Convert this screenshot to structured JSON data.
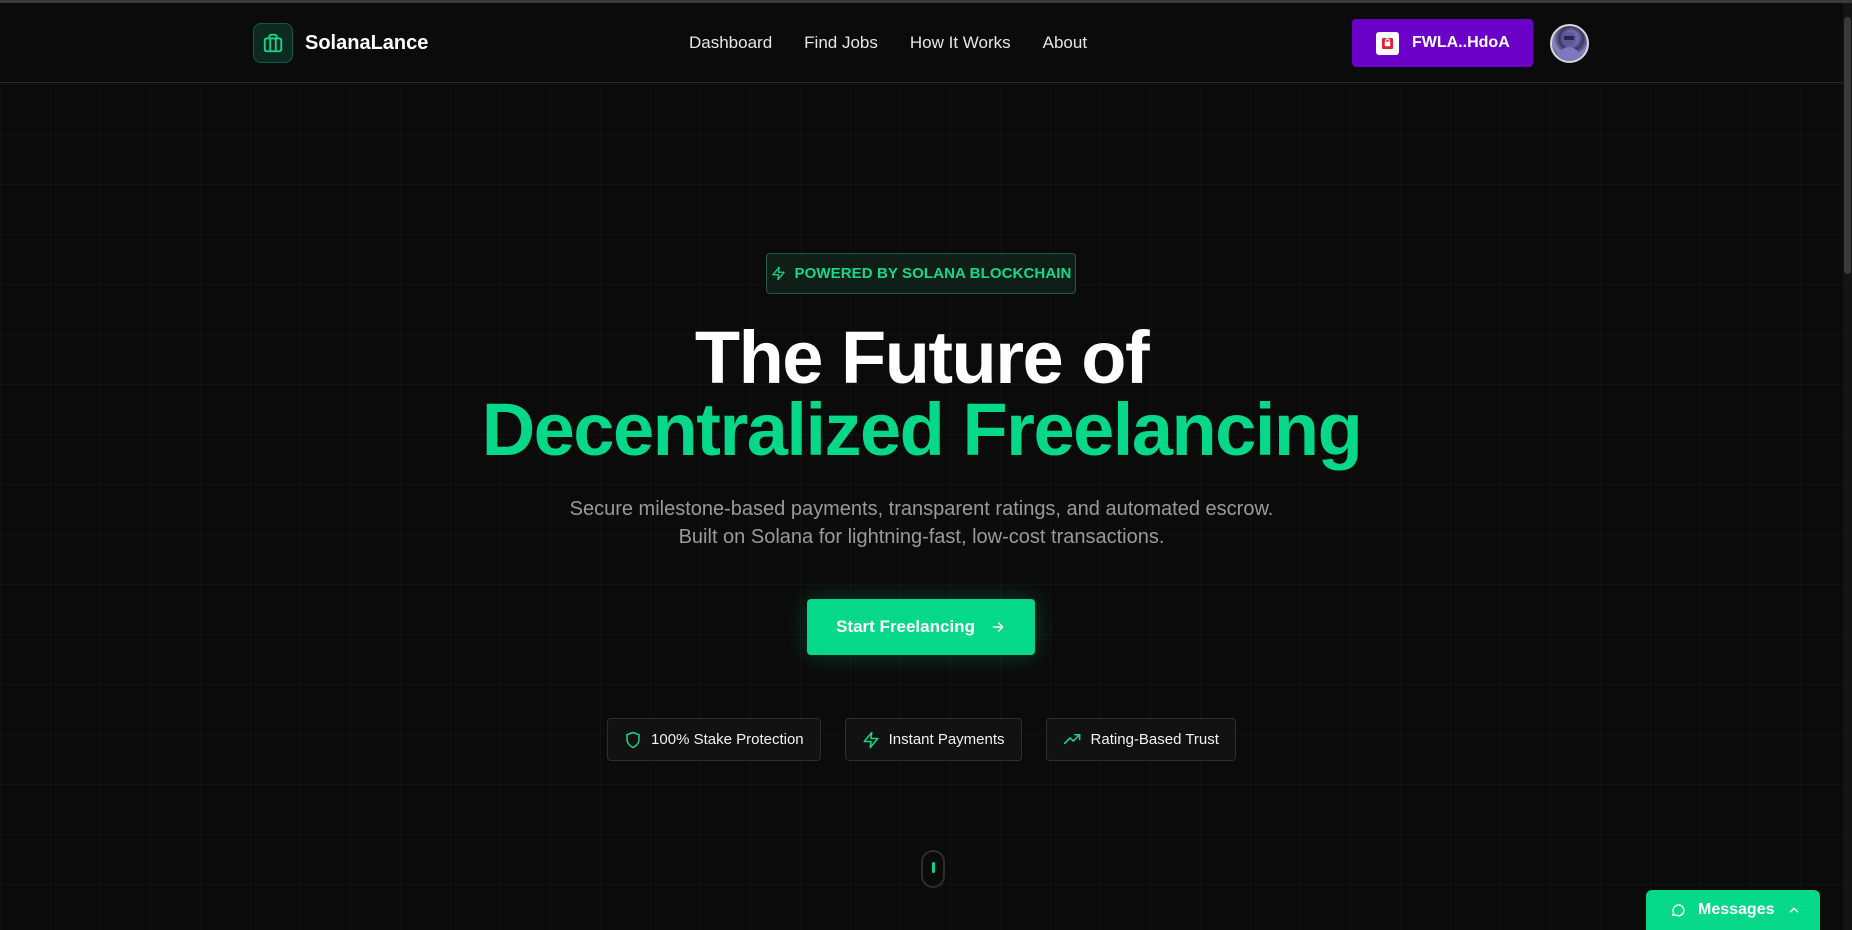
{
  "brand": {
    "name": "SolanaLance",
    "accent": "#06d889",
    "wallet_color": "#6b00c8"
  },
  "nav": {
    "links": [
      {
        "label": "Dashboard"
      },
      {
        "label": "Find Jobs"
      },
      {
        "label": "How It Works"
      },
      {
        "label": "About"
      }
    ]
  },
  "wallet": {
    "address": "FWLA..HdoA",
    "icon": "wallet-app-icon"
  },
  "hero": {
    "badge": "POWERED BY SOLANA BLOCKCHAIN",
    "title_line1": "The Future of",
    "title_line2": "Decentralized Freelancing",
    "subtitle": "Secure milestone-based payments, transparent ratings, and automated escrow. Built on Solana for lightning-fast, low-cost transactions.",
    "cta_label": "Start Freelancing"
  },
  "features": [
    {
      "label": "100% Stake Protection",
      "icon": "shield-icon"
    },
    {
      "label": "Instant Payments",
      "icon": "lightning-icon"
    },
    {
      "label": "Rating-Based Trust",
      "icon": "trending-up-icon"
    }
  ],
  "messages": {
    "label": "Messages"
  }
}
